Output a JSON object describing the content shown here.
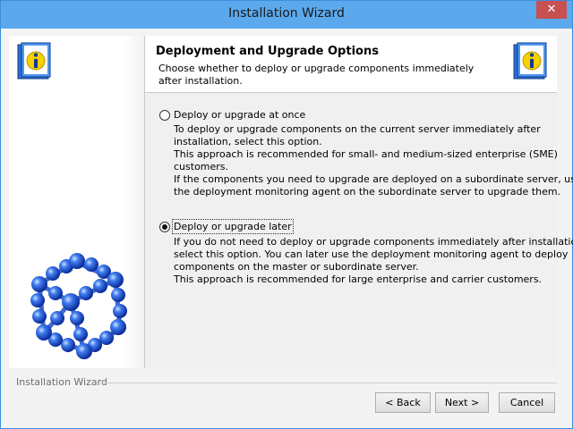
{
  "window": {
    "title": "Installation Wizard",
    "close_glyph": "✕"
  },
  "header": {
    "title": "Deployment and Upgrade Options",
    "subtitle": "Choose whether to deploy or upgrade components immediately after installation."
  },
  "options": [
    {
      "label": "Deploy or upgrade at once",
      "selected": false,
      "description_lines": [
        "To deploy or upgrade components on the current server immediately after",
        "installation, select this option.",
        "This approach is recommended for small- and medium-sized enterprise (SME)",
        "customers.",
        "If the components you need to upgrade are deployed on a subordinate server, use",
        "the deployment monitoring agent on the subordinate server to upgrade them."
      ]
    },
    {
      "label": "Deploy or upgrade later",
      "selected": true,
      "description_lines": [
        "If you do not need to deploy or upgrade components immediately after installation,",
        "select this option. You can later use the deployment monitoring agent to deploy",
        "components on the master or subordinate server.",
        "This approach is recommended for large enterprise and carrier customers."
      ]
    }
  ],
  "footer": {
    "label": "Installation Wizard"
  },
  "buttons": {
    "back": "< Back",
    "next": "Next >",
    "cancel": "Cancel"
  },
  "icons": {
    "info_book": "info-book-icon",
    "molecule": "molecule-graphic"
  },
  "colors": {
    "titlebar": "#5ba9ec",
    "close": "#c75050",
    "accent_blue": "#1a5ed8"
  }
}
